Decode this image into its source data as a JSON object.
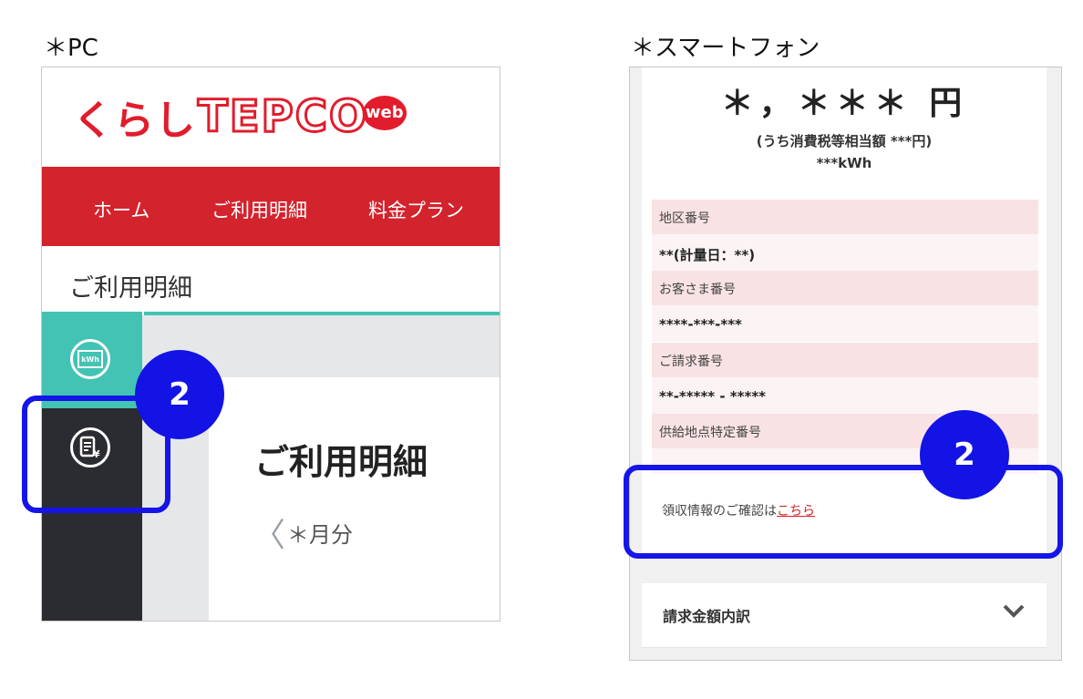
{
  "captions": {
    "pc": "＊PC",
    "smartphone": "＊スマートフォン"
  },
  "pc": {
    "logo": {
      "kana": "くらし",
      "brand": "TEPCO",
      "badge": "web"
    },
    "nav": {
      "home": "ホーム",
      "usage": "ご利用明細",
      "plan": "料金プラン"
    },
    "subtitle": "ご利用明細",
    "kwh_icon_label": "kWh",
    "heading": "ご利用明細",
    "month": "＊月分",
    "callout_number": "2"
  },
  "smartphone": {
    "amount": "＊，＊＊＊ 円",
    "tax_note": "(うち消費税等相当額 ***円)",
    "usage_kwh": "***kWh",
    "fields": {
      "area_label": "地区番号",
      "area_value": "**(計量日：**)",
      "customer_label": "お客さま番号",
      "customer_value": "****-***-***",
      "billing_label": "ご請求番号",
      "billing_value": "**-***** - *****",
      "supply_label": "供給地点特定番号"
    },
    "receipt_text": "領収情報のご確認は",
    "receipt_link": "こちら",
    "breakdown_label": "請求金額内訳",
    "callout_number": "2"
  },
  "colors": {
    "brand_red": "#d3232d",
    "teal": "#43c3b3",
    "callout_blue": "#1515e8",
    "sidebar_dark": "#2b2c31"
  },
  "icons": [
    "kwh-meter-icon",
    "bill-yen-icon",
    "chevron-left-icon",
    "chevron-down-icon"
  ]
}
